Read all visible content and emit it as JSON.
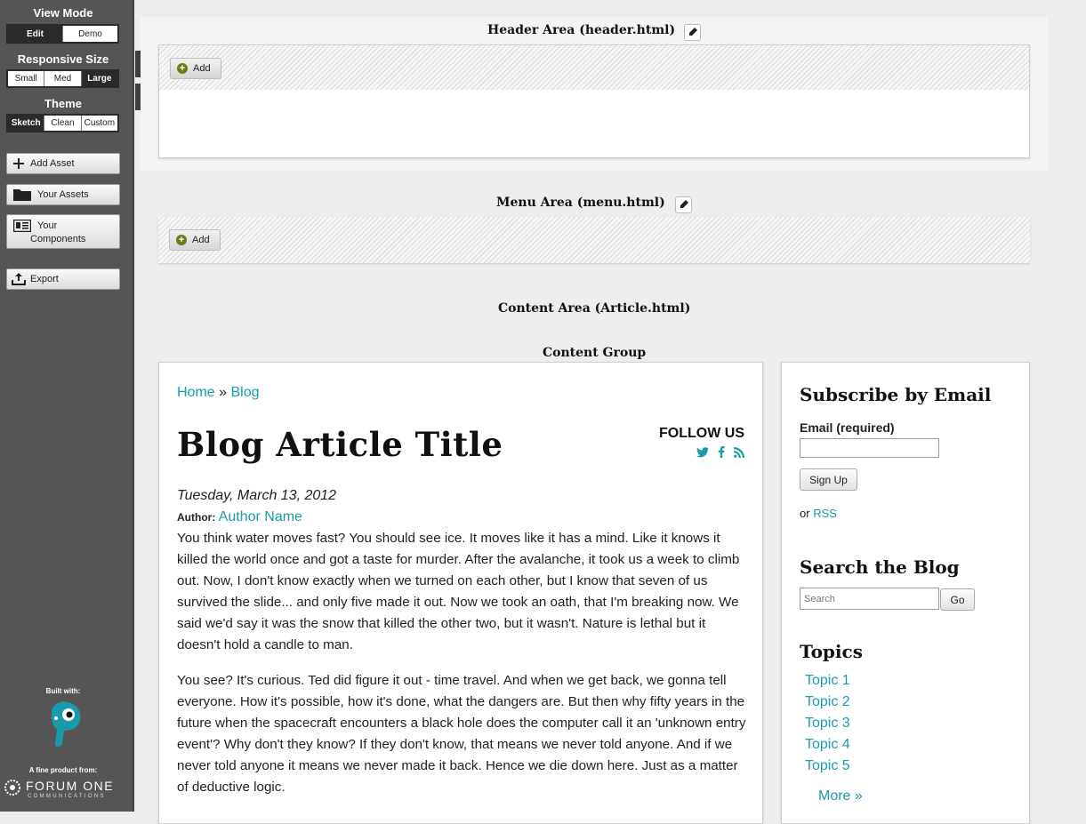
{
  "sidebar": {
    "view_mode": {
      "title": "View Mode",
      "options": [
        "Edit",
        "Demo"
      ],
      "selected": "Edit"
    },
    "responsive": {
      "title": "Responsive Size",
      "options": [
        "Small",
        "Med",
        "Large"
      ],
      "selected": "Large"
    },
    "theme": {
      "title": "Theme",
      "options": [
        "Sketch",
        "Clean",
        "Custom"
      ],
      "selected": "Sketch"
    },
    "buttons": {
      "add_asset": "Add Asset",
      "your_assets": "Your Assets",
      "your_components_1": "Your",
      "your_components_2": "Components",
      "export": "Export"
    },
    "built_with": "Built with:",
    "fine_product": "A fine product from:",
    "brand": "FORUM ONE",
    "brand_sub": "COMMUNICATIONS"
  },
  "header_area": {
    "title": "Header Area (header.html)",
    "add_label": "Add"
  },
  "menu_area": {
    "title": "Menu Area (menu.html)",
    "add_label": "Add"
  },
  "content_area": {
    "title": "Content Area (Article.html)",
    "group_title": "Content Group"
  },
  "article": {
    "breadcrumb": {
      "home": "Home",
      "sep": " » ",
      "blog": "Blog"
    },
    "title": "Blog Article Title",
    "follow_us": "FOLLOW US",
    "date": "Tuesday, March 13, 2012",
    "author_label": "Author:",
    "author_name": "Author Name",
    "para1": "You think water moves fast? You should see ice. It moves like it has a mind. Like it knows it killed the world once and got a taste for murder. After the avalanche, it took us a week to climb out. Now, I don't know exactly when we turned on each other, but I know that seven of us survived the slide... and only five made it out. Now we took an oath, that I'm breaking now. We said we'd say it was the snow that killed the other two, but it wasn't. Nature is lethal but it doesn't hold a candle to man.",
    "para2": "You see? It's curious. Ted did figure it out - time travel. And when we get back, we gonna tell everyone. How it's possible, how it's done, what the dangers are. But then why fifty years in the future when the spacecraft encounters a black hole does the computer call it an 'unknown entry event'? Why don't they know? If they don't know, that means we never told anyone. And if we never told anyone it means we never made it back. Hence we die down here. Just as a matter of deductive logic."
  },
  "side": {
    "subscribe_title": "Subscribe by Email",
    "email_label": "Email (required)",
    "email_value": "",
    "signup_label": "Sign Up",
    "or_text": "or",
    "rss_text": "RSS",
    "search_title": "Search the Blog",
    "search_placeholder": "Search",
    "go_label": "Go",
    "topics_title": "Topics",
    "topics": [
      "Topic 1",
      "Topic 2",
      "Topic 3",
      "Topic 4",
      "Topic 5"
    ],
    "more": "More »"
  },
  "colors": {
    "link": "#1a9baa",
    "sidebar_bg": "#555555",
    "accent_olive": "#6d7a16"
  }
}
